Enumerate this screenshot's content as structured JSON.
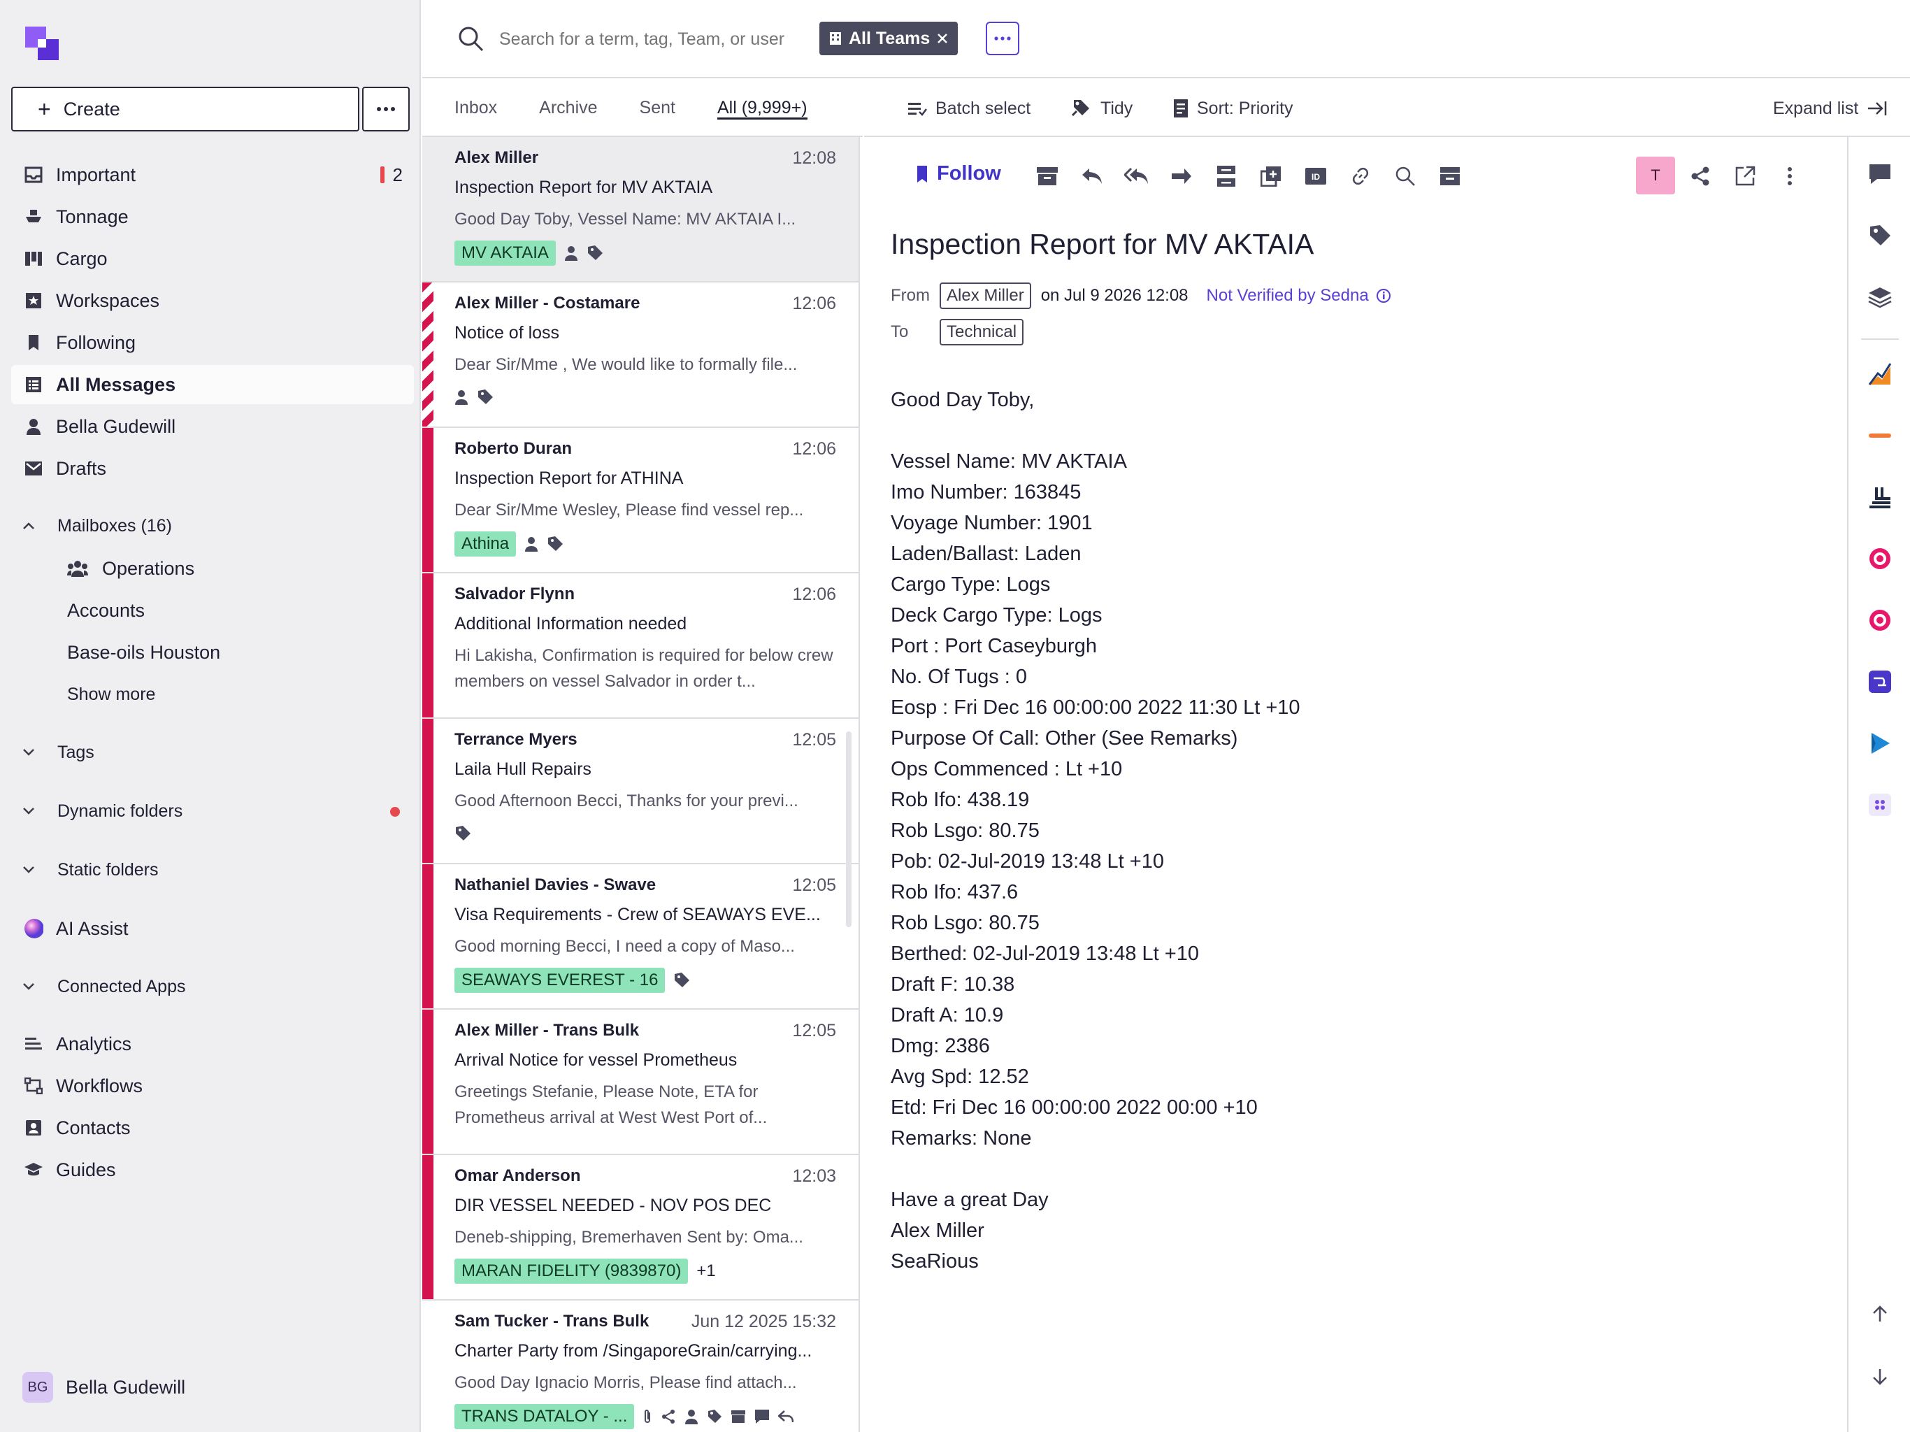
{
  "sidebar": {
    "create_label": "Create",
    "nav": [
      {
        "label": "Important",
        "count": "2"
      },
      {
        "label": "Tonnage"
      },
      {
        "label": "Cargo"
      },
      {
        "label": "Workspaces"
      },
      {
        "label": "Following"
      },
      {
        "label": "All Messages"
      },
      {
        "label": "Bella Gudewill"
      },
      {
        "label": "Drafts"
      }
    ],
    "mailboxes_label": "Mailboxes (16)",
    "mailboxes": [
      "Operations",
      "Accounts",
      "Base-oils Houston"
    ],
    "show_more": "Show more",
    "groups": [
      "Tags",
      "Dynamic folders",
      "Static folders"
    ],
    "ai_assist": "AI Assist",
    "connected_apps": "Connected Apps",
    "bottom_nav": [
      "Analytics",
      "Workflows",
      "Contacts",
      "Guides"
    ],
    "user": {
      "initials": "BG",
      "name": "Bella Gudewill"
    }
  },
  "search": {
    "placeholder": "Search for a term, tag, Team, or user",
    "team_chip": "All Teams"
  },
  "tabs": [
    "Inbox",
    "Archive",
    "Sent",
    "All (9,999+)"
  ],
  "list_tools": {
    "batch": "Batch select",
    "tidy": "Tidy",
    "sort": "Sort: Priority",
    "expand": "Expand list"
  },
  "messages": [
    {
      "sender": "Alex Miller",
      "time": "12:08",
      "subject": "Inspection Report for MV AKTAIA",
      "preview": "Good Day Toby, Vessel Name: MV AKTAIA I...",
      "tag": "MV AKTAIA"
    },
    {
      "sender": "Alex Miller - Costamare",
      "time": "12:06",
      "subject": "Notice of loss",
      "preview": "Dear Sir/Mme , We would like to formally file..."
    },
    {
      "sender": "Roberto Duran",
      "time": "12:06",
      "subject": "Inspection Report for ATHINA",
      "preview": "Dear Sir/Mme Wesley, Please find vessel rep...",
      "tag": "Athina"
    },
    {
      "sender": "Salvador Flynn",
      "time": "12:06",
      "subject": "Additional Information needed",
      "preview": "Hi Lakisha, Confirmation is required for below crew members on vessel Salvador in order t..."
    },
    {
      "sender": "Terrance Myers",
      "time": "12:05",
      "subject": "Laila Hull Repairs",
      "preview": "Good Afternoon Becci, Thanks for your previ..."
    },
    {
      "sender": "Nathaniel Davies - Swave",
      "time": "12:05",
      "subject": "Visa Requirements - Crew of SEAWAYS EVE...",
      "preview": "Good morning Becci, I need a copy of Maso...",
      "tag": "SEAWAYS EVEREST - 16"
    },
    {
      "sender": "Alex Miller - Trans Bulk",
      "time": "12:05",
      "subject": "Arrival Notice for vessel Prometheus",
      "preview": "Greetings Stefanie, Please Note, ETA for Prometheus arrival at West West Port of..."
    },
    {
      "sender": "Omar Anderson",
      "time": "12:03",
      "subject": "DIR VESSEL NEEDED - NOV POS DEC",
      "preview": "Deneb-shipping, Bremerhaven Sent by: Oma...",
      "tag": "MARAN FIDELITY (9839870)",
      "extra": "+1"
    },
    {
      "sender": "Sam Tucker - Trans Bulk",
      "time": "Jun 12 2025 15:32",
      "subject": "Charter Party from /SingaporeGrain/carrying...",
      "preview": "Good Day Ignacio Morris, Please find attach...",
      "tag": "TRANS DATALOY - ..."
    }
  ],
  "reader": {
    "follow": "Follow",
    "avatar": "T",
    "title": "Inspection Report for MV AKTAIA",
    "from_label": "From",
    "from": "Alex Miller",
    "date": "on Jul 9 2026 12:08",
    "verify": "Not Verified by Sedna",
    "to_label": "To",
    "to": "Technical",
    "body": "Good Day Toby,\n\nVessel Name: MV AKTAIA\nImo Number: 163845\nVoyage Number: 1901\nLaden/Ballast: Laden\nCargo Type: Logs\nDeck Cargo Type: Logs\nPort : Port Caseyburgh\nNo. Of Tugs : 0\nEosp : Fri Dec 16 00:00:00 2022 11:30 Lt +10\nPurpose Of Call: Other (See Remarks)\nOps Commenced : Lt +10\nRob Ifo: 438.19\nRob Lsgo: 80.75\nPob: 02-Jul-2019 13:48 Lt +10\nRob Ifo: 437.6\nRob Lsgo: 80.75\nBerthed: 02-Jul-2019 13:48 Lt +10\nDraft F: 10.38\nDraft A: 10.9\nDmg: 2386\nAvg Spd: 12.52\nEtd: Fri Dec 16 00:00:00 2022 00:00 +10\nRemarks: None\n\nHave a great Day\nAlex Miller\nSeaRious"
  },
  "colors": {
    "accent": "#5b3ed6",
    "priority": "#d4144d",
    "tag": "#8fe3b9"
  }
}
